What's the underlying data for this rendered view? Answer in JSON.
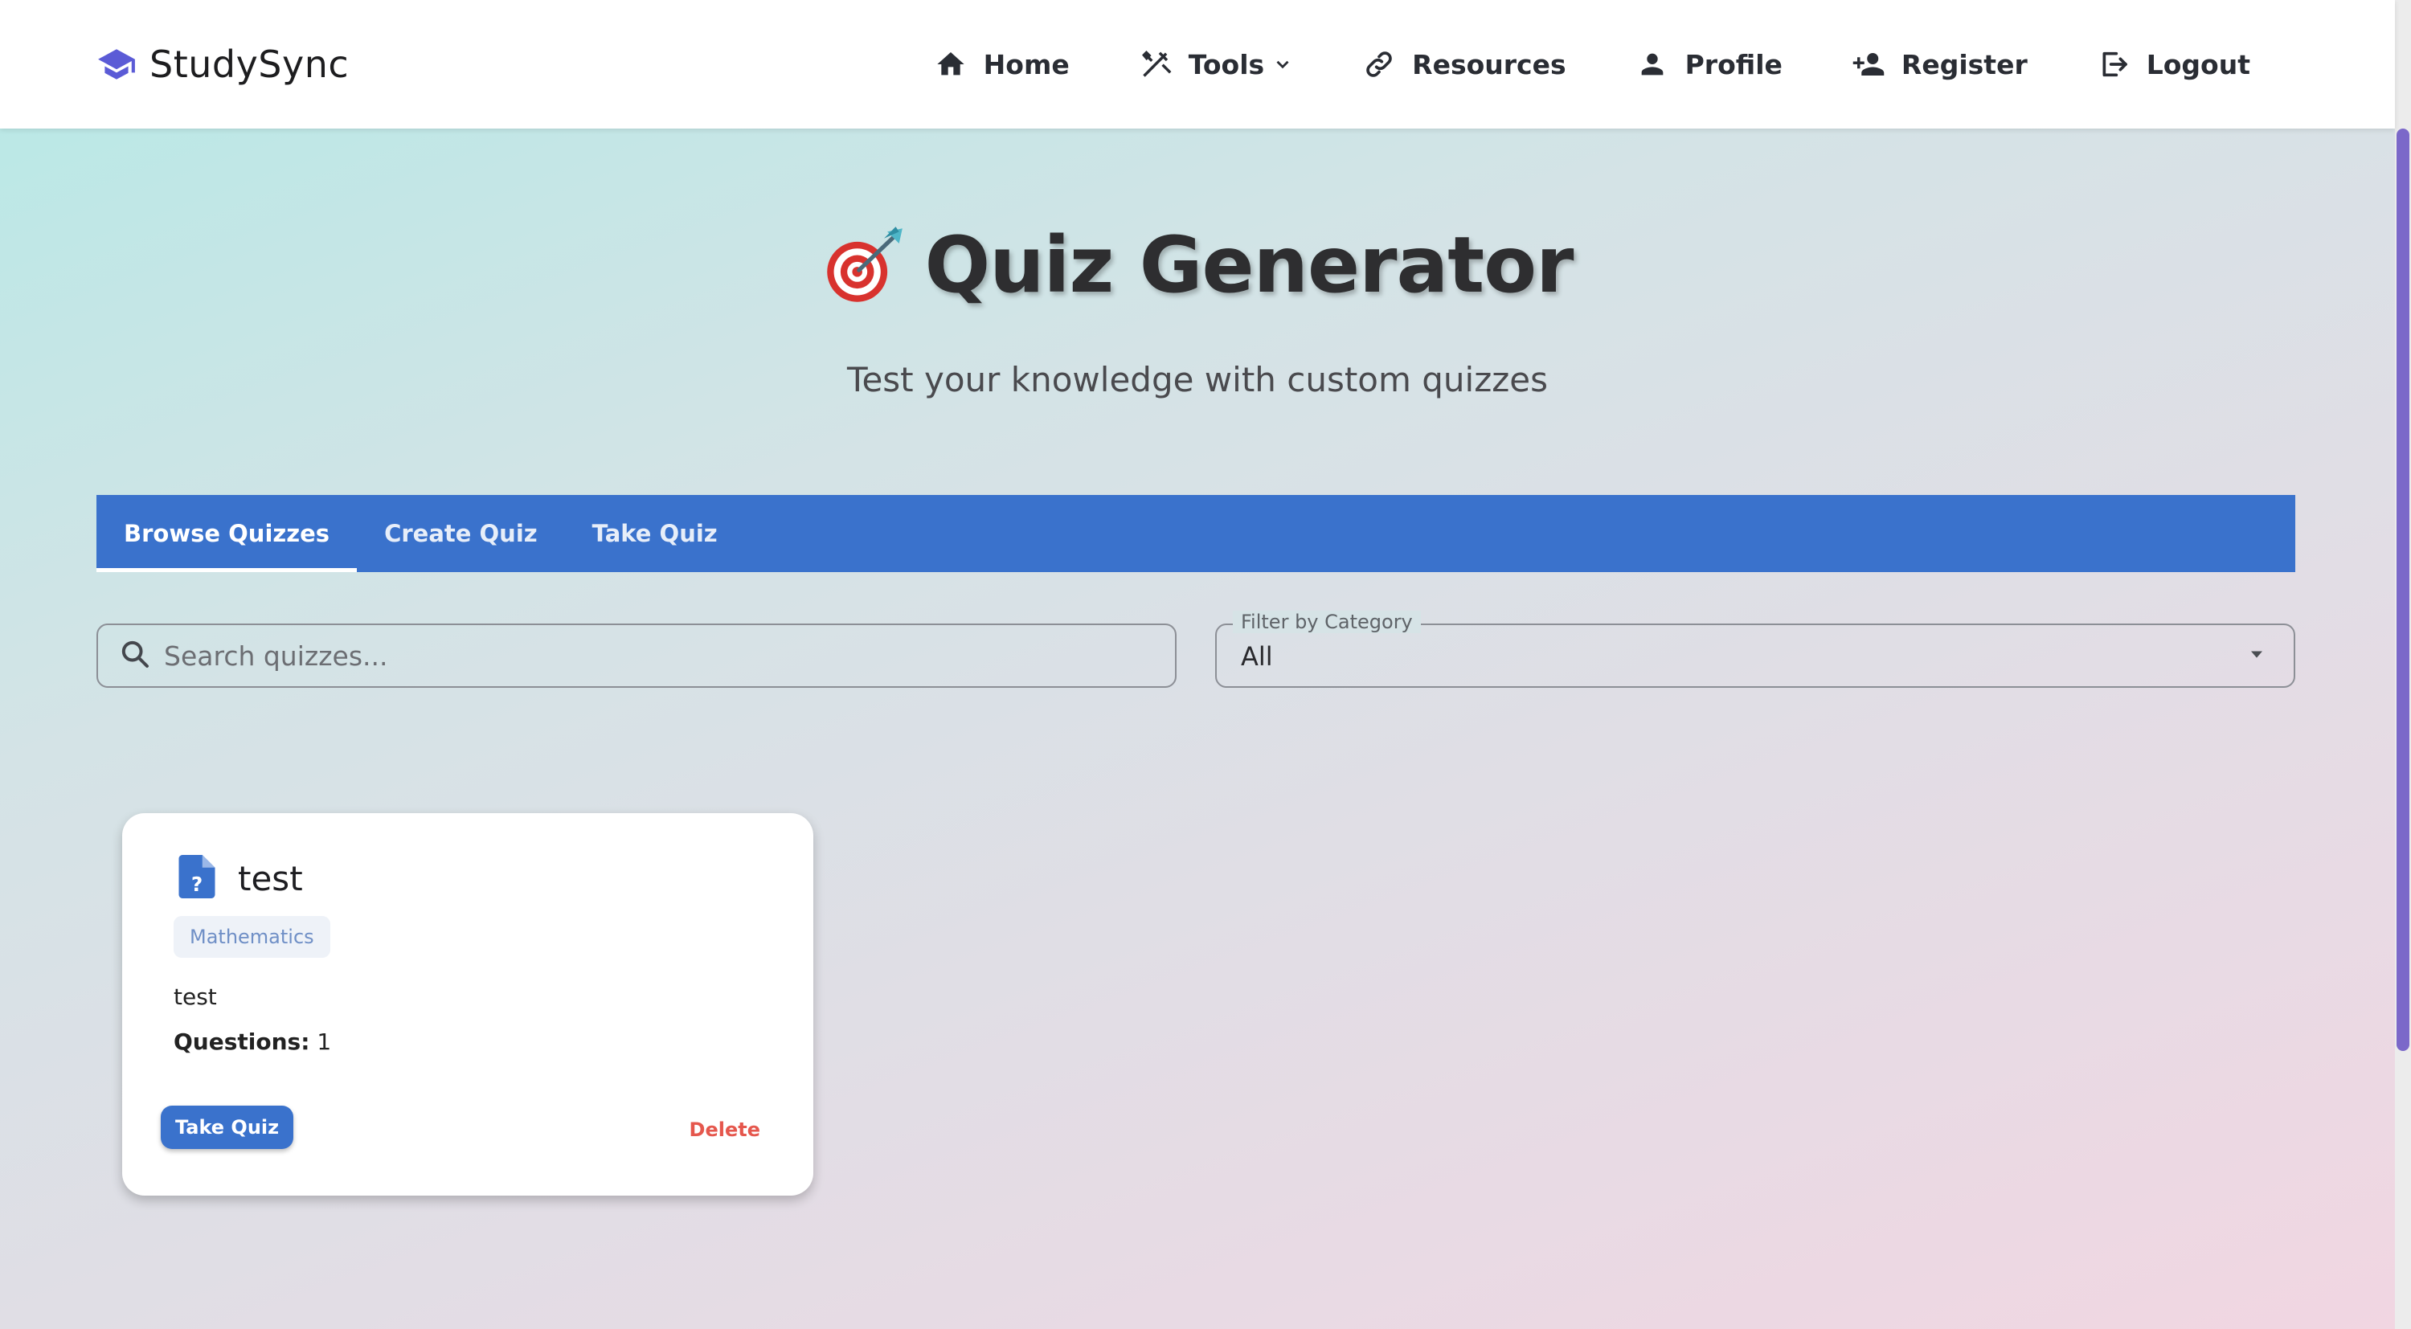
{
  "brand": {
    "name": "StudySync",
    "icon": "graduation-cap-icon",
    "color": "#5b5bd6"
  },
  "nav": {
    "items": [
      {
        "label": "Home",
        "icon": "home-icon"
      },
      {
        "label": "Tools",
        "icon": "tools-icon",
        "has_dropdown": true
      },
      {
        "label": "Resources",
        "icon": "link-icon"
      },
      {
        "label": "Profile",
        "icon": "person-icon"
      },
      {
        "label": "Register",
        "icon": "person-add-icon"
      },
      {
        "label": "Logout",
        "icon": "logout-icon"
      }
    ]
  },
  "hero": {
    "emoji": "dart-target-icon",
    "title": "Quiz Generator",
    "subtitle": "Test your knowledge with custom quizzes"
  },
  "tabs": {
    "items": [
      {
        "label": "Browse Quizzes",
        "active": true
      },
      {
        "label": "Create Quiz",
        "active": false
      },
      {
        "label": "Take Quiz",
        "active": false
      }
    ],
    "color": "#3a72cc"
  },
  "filters": {
    "search_placeholder": "Search quizzes...",
    "search_value": "",
    "category_label": "Filter by Category",
    "category_value": "All"
  },
  "quizzes": [
    {
      "title": "test",
      "icon": "quiz-document-icon",
      "category": "Mathematics",
      "description": "test",
      "questions_label": "Questions:",
      "questions_count": "1",
      "take_label": "Take Quiz",
      "delete_label": "Delete"
    }
  ],
  "colors": {
    "accent": "#3a72cc",
    "danger": "#e5574d",
    "scrollbar": "#7b68c9"
  }
}
